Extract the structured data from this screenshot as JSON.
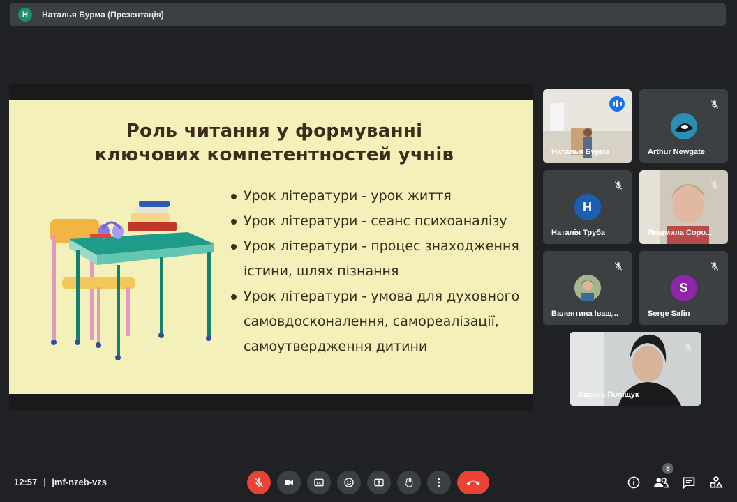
{
  "presenter": {
    "initial": "Н",
    "title": "Наталья Бурма (Презентація)"
  },
  "slide": {
    "title_line1": "Роль читання у формуванні",
    "title_line2": "ключових компетентностей учнів",
    "bullets": [
      {
        "line1": "Урок літератури - урок життя"
      },
      {
        "line1": "Урок літератури - сеанс психоаналізу"
      },
      {
        "line1": "Урок літератури - процес знаходження",
        "line2": "істини, шлях пізнання"
      },
      {
        "line1": "Урок літератури - умова для духовного",
        "line2": "самовдосконалення, самореалізації,",
        "line3": "самоутвердження дитини"
      }
    ]
  },
  "participants": [
    {
      "name": "Наталья Бурма",
      "type": "video",
      "speaking": true
    },
    {
      "name": "Arthur Newgate",
      "type": "avatar-image",
      "muted": true
    },
    {
      "name": "Наталія Труба",
      "type": "initial",
      "initial": "Н",
      "color": "#1a5fb4",
      "muted": true
    },
    {
      "name": "Людмила Соро...",
      "type": "video",
      "muted": true
    },
    {
      "name": "Валентина Іващ...",
      "type": "avatar-image",
      "muted": true
    },
    {
      "name": "Serge Safin",
      "type": "initial",
      "initial": "S",
      "color": "#8e24aa",
      "muted": true
    },
    {
      "name": "Оксана Поліщук",
      "type": "video",
      "muted": true
    }
  ],
  "meeting": {
    "time": "12:57",
    "code": "jmf-nzeb-vzs",
    "participant_count": "8"
  },
  "controls": [
    "mic-off",
    "camera",
    "captions",
    "emoji",
    "present",
    "raise-hand",
    "more",
    "end-call"
  ],
  "right_controls": [
    "info",
    "people",
    "chat",
    "activities"
  ],
  "colors": {
    "background": "#202124",
    "tile": "#3c4043",
    "danger": "#ea4335",
    "active_outline": "#8ab4f8",
    "slide_bg": "#f4f0b9"
  }
}
